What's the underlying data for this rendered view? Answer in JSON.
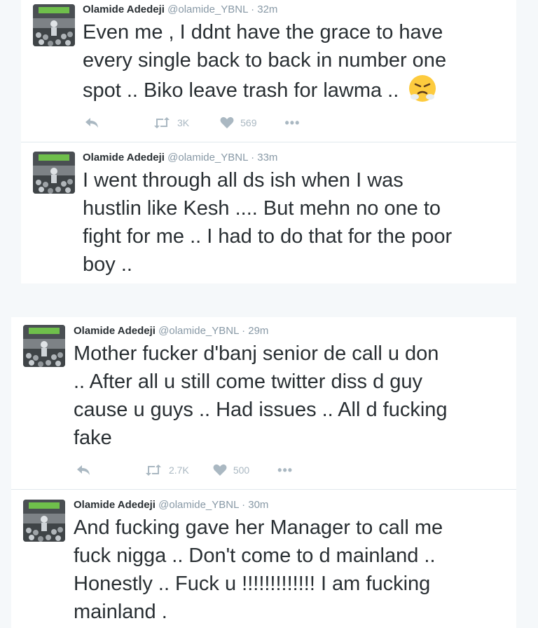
{
  "colors": {
    "background": "#f5f8fa",
    "card": "#ffffff",
    "name": "#292f33",
    "meta": "#8899a6",
    "icon": "#aab8c2",
    "divider": "#e1e8ed"
  },
  "tweets": [
    {
      "name": "Olamide Adedeji",
      "handle": "@olamide_YBNL",
      "separator": "·",
      "time": "32m",
      "lines": [
        "Even me , I ddnt have the grace to have",
        "every single back to back in number one",
        "spot .. Biko leave trash for lawma .."
      ],
      "emoji": "angry-steam-face-emoji",
      "retweets": "3K",
      "likes": "569",
      "more": "•••"
    },
    {
      "name": "Olamide Adedeji",
      "handle": "@olamide_YBNL",
      "separator": "·",
      "time": "33m",
      "lines": [
        "I went through all ds ish when I was",
        "hustlin like Kesh .... But mehn no one to",
        "fight for me .. I had to do that for the poor",
        "boy .."
      ]
    },
    {
      "name": "Olamide Adedeji",
      "handle": "@olamide_YBNL",
      "separator": "·",
      "time": "29m",
      "lines": [
        "Mother fucker d'banj senior de call u don",
        ".. After all u still come twitter diss d guy",
        "cause u guys .. Had issues .. All d fucking",
        "fake"
      ],
      "retweets": "2.7K",
      "likes": "500",
      "more": "•••"
    },
    {
      "name": "Olamide Adedeji",
      "handle": "@olamide_YBNL",
      "separator": "·",
      "time": "30m",
      "lines": [
        "And fucking gave her Manager to call me",
        "fuck nigga .. Don't come to d mainland ..",
        "Honestly .. Fuck u !!!!!!!!!!!!! I am fucking",
        "mainland ."
      ]
    }
  ]
}
